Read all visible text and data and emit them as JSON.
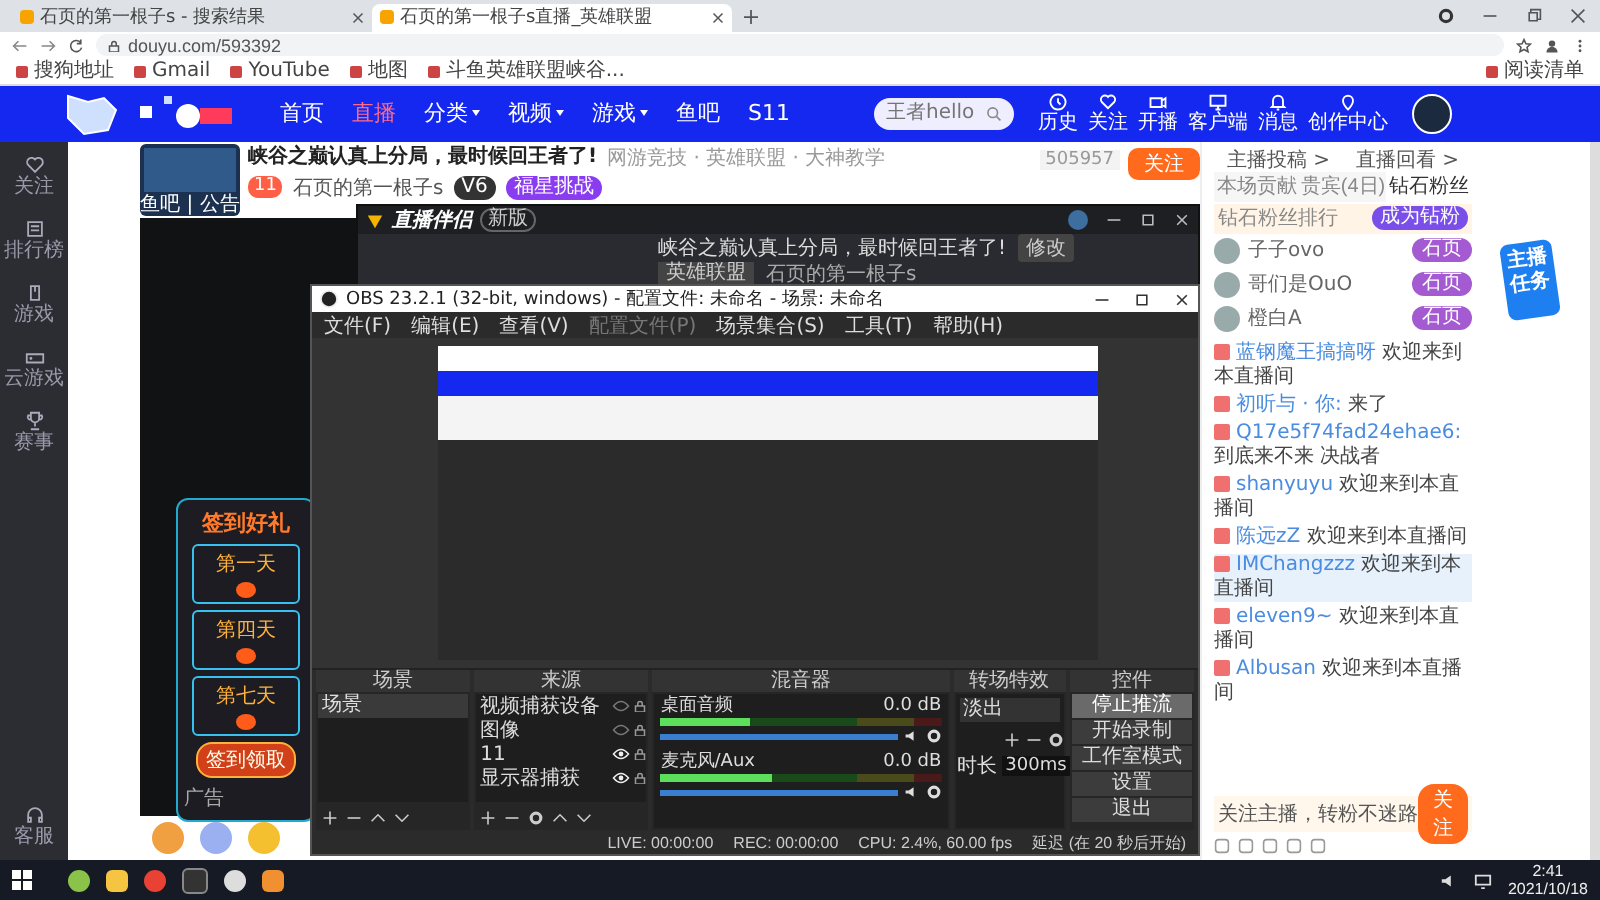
{
  "browser": {
    "tabs": [
      {
        "title": "石页的第一根子s - 搜索结果",
        "selected": false
      },
      {
        "title": "石页的第一根子s直播_英雄联盟",
        "selected": true
      }
    ],
    "url": "douyu.com/593392",
    "bookmarks": [
      "搜狗地址",
      "Gmail",
      "YouTube",
      "地图",
      "斗鱼英雄联盟峡谷..."
    ],
    "reading_list": "阅读清单"
  },
  "site_nav": {
    "items": [
      {
        "label": "首页",
        "selected": false,
        "dropdown": false
      },
      {
        "label": "直播",
        "selected": true,
        "dropdown": false
      },
      {
        "label": "分类",
        "selected": false,
        "dropdown": true
      },
      {
        "label": "视频",
        "selected": false,
        "dropdown": true
      },
      {
        "label": "游戏",
        "selected": false,
        "dropdown": true
      },
      {
        "label": "鱼吧",
        "selected": false,
        "dropdown": false
      },
      {
        "label": "S11",
        "selected": false,
        "dropdown": false
      }
    ],
    "search": {
      "placeholder": "王者hello"
    },
    "tools": [
      {
        "label": "历史"
      },
      {
        "label": "关注"
      },
      {
        "label": "开播"
      },
      {
        "label": "客户端"
      },
      {
        "label": "消息"
      },
      {
        "label": "创作中心"
      }
    ]
  },
  "sidebar": [
    {
      "label": "关注"
    },
    {
      "label": "排行榜"
    },
    {
      "label": "游戏"
    },
    {
      "label": "云游戏"
    },
    {
      "label": "赛事"
    },
    {
      "label": "客服"
    }
  ],
  "stream": {
    "title": "峡谷之巅认真上分局，最时候回王者了!",
    "category": "网游竞技 · 英雄联盟 · 大神教学",
    "level": "11",
    "streamer": "石页的第一根子s",
    "tags": [
      "V6",
      "福星挑战"
    ],
    "room_number": "505957",
    "follow": "关注",
    "avatar_caption": "鱼吧 | 公告"
  },
  "ad": {
    "title": "签到好礼",
    "days": [
      "第一天",
      "第四天",
      "第七天"
    ],
    "button": "签到领取",
    "tag": "广告"
  },
  "companion": {
    "title": "直播伴侣",
    "tag": "新版",
    "stream_title": "峡谷之巅认真上分局，最时候回王者了!",
    "edit": "修改",
    "category": "英雄联盟",
    "streamer": "石页的第一根子s"
  },
  "obs": {
    "title": "OBS 23.2.1 (32-bit, windows) - 配置文件: 未命名 - 场景: 未命名",
    "menu": [
      {
        "label": "文件(F)",
        "disabled": false
      },
      {
        "label": "编辑(E)",
        "disabled": false
      },
      {
        "label": "查看(V)",
        "disabled": false
      },
      {
        "label": "配置文件(P)",
        "disabled": true
      },
      {
        "label": "场景集合(S)",
        "disabled": false
      },
      {
        "label": "工具(T)",
        "disabled": false
      },
      {
        "label": "帮助(H)",
        "disabled": false
      }
    ],
    "scenes": {
      "title": "场景",
      "items": [
        {
          "label": "场景",
          "selected": true
        }
      ]
    },
    "sources": {
      "title": "来源",
      "items": [
        {
          "label": "视频捕获设备",
          "visible": false
        },
        {
          "label": "图像",
          "visible": false
        },
        {
          "label": "11",
          "visible": true
        },
        {
          "label": "显示器捕获",
          "visible": true
        }
      ]
    },
    "mixer": {
      "title": "混音器",
      "channels": [
        {
          "name": "桌面音频",
          "reading": "0.0 dB",
          "meter": {
            "level": 0.32
          },
          "volume": {
            "level": 1
          }
        },
        {
          "name": "麦克风/Aux",
          "reading": "0.0 dB",
          "meter": {
            "level": 0.4
          },
          "volume": {
            "level": 1
          }
        }
      ]
    },
    "transitions": {
      "title": "转场特效",
      "selected": "淡出",
      "duration_label": "时长",
      "duration": "300ms"
    },
    "controls": {
      "title": "控件",
      "buttons": [
        {
          "label": "停止推流",
          "active": true
        },
        {
          "label": "开始录制",
          "active": false
        },
        {
          "label": "工作室模式",
          "active": false
        },
        {
          "label": "设置",
          "active": false
        },
        {
          "label": "退出",
          "active": false
        }
      ]
    },
    "status": [
      "LIVE: 00:00:00",
      "REC: 00:00:00",
      "CPU: 2.4%, 60.00 fps",
      "延迟 (在 20 秒后开始)"
    ]
  },
  "chat": {
    "links": [
      "主播投稿 >",
      "直播回看 >"
    ],
    "tabs": [
      {
        "label": "本场贡献",
        "selected": false
      },
      {
        "label": "贵宾(4日)",
        "selected": false
      },
      {
        "label": "钻石粉丝",
        "selected": true
      }
    ],
    "banner": "钻石粉丝排行",
    "join": "成为钻粉",
    "ranking": [
      {
        "name": "子子ovo",
        "badge": "石页"
      },
      {
        "name": "哥们是OuO",
        "badge": "石页"
      },
      {
        "name": "橙白A",
        "badge": "石页"
      }
    ],
    "messages": [
      {
        "user": "蓝钢魔王搞搞呀",
        "text": "欢迎来到本直播间",
        "highlighted": false
      },
      {
        "user": "初听与 · 你:",
        "text": "来了",
        "highlighted": false
      },
      {
        "user": "Q17e5f74fad24ehae6:",
        "text": "到底来不来 决战者",
        "highlighted": false
      },
      {
        "user": "shanyuyu",
        "text": "欢迎来到本直播间",
        "highlighted": false
      },
      {
        "user": "陈远zZ",
        "text": "欢迎来到本直播间",
        "highlighted": false
      },
      {
        "user": "IMChangzzz",
        "text": "欢迎来到本直播间",
        "highlighted": true
      },
      {
        "user": "eleven9~",
        "text": "欢迎来到本直播间",
        "highlighted": false
      },
      {
        "user": "Albusan",
        "text": "欢迎来到本直播间",
        "highlighted": false
      }
    ],
    "follow_prompt": "关注主播，转粉不迷路",
    "follow_button": "关注"
  },
  "task_badge": "主播任务",
  "taskbar": {
    "time": "2:41",
    "date": "2021/10/18"
  }
}
